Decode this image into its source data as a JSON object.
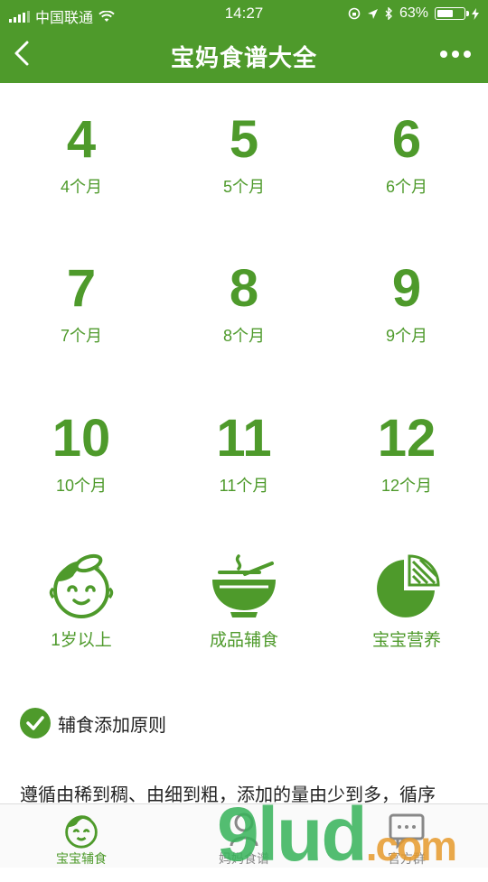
{
  "status_bar": {
    "carrier": "中国联通",
    "time": "14:27",
    "battery": "63%",
    "battery_level": 0.63
  },
  "nav": {
    "title": "宝妈食谱大全"
  },
  "months": [
    {
      "num": "4",
      "label": "4个月"
    },
    {
      "num": "5",
      "label": "5个月"
    },
    {
      "num": "6",
      "label": "6个月"
    },
    {
      "num": "7",
      "label": "7个月"
    },
    {
      "num": "8",
      "label": "8个月"
    },
    {
      "num": "9",
      "label": "9个月"
    },
    {
      "num": "10",
      "label": "10个月"
    },
    {
      "num": "11",
      "label": "11个月"
    },
    {
      "num": "12",
      "label": "12个月"
    }
  ],
  "categories": [
    {
      "label": "1岁以上",
      "icon": "baby-face-icon"
    },
    {
      "label": "成品辅食",
      "icon": "food-bowl-icon"
    },
    {
      "label": "宝宝营养",
      "icon": "pie-chart-icon"
    }
  ],
  "principle": {
    "title": "辅食添加原则",
    "text": "遵循由稀到稠、由细到粗，添加的量由少到多，循序"
  },
  "tabs": [
    {
      "label": "宝宝辅食",
      "icon": "baby-face-icon",
      "active": true
    },
    {
      "label": "妈妈食谱",
      "icon": "mother-icon",
      "active": false
    },
    {
      "label": "官方群",
      "icon": "chat-icon",
      "active": false
    }
  ],
  "watermark": {
    "main": "9lud",
    "suffix": ".com"
  },
  "colors": {
    "brand_green": "#4e9a2b",
    "tab_inactive": "#888888"
  }
}
